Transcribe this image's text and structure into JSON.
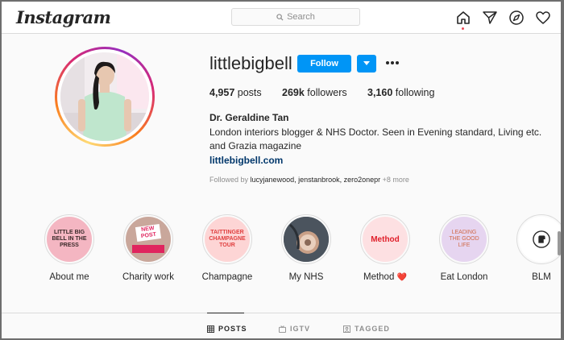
{
  "nav": {
    "logo": "Instagram",
    "search_placeholder": "Search",
    "icons": [
      "home-icon",
      "direct-message-icon",
      "explore-compass-icon",
      "activity-heart-icon"
    ]
  },
  "profile": {
    "username": "littlebigbell",
    "follow_label": "Follow",
    "stats": {
      "posts_count": "4,957",
      "posts_label": "posts",
      "followers_count": "269k",
      "followers_label": "followers",
      "following_count": "3,160",
      "following_label": "following"
    },
    "full_name": "Dr. Geraldine Tan",
    "bio": "London interiors blogger & NHS Doctor. Seen in Evening standard, Living etc. and Grazia magazine",
    "website": "littlebigbell.com",
    "followed_by_prefix": "Followed by",
    "followed_by": "lucyjanewood, jenstanbrook, zero2onepr",
    "followed_by_more": "+8 more"
  },
  "highlights": [
    {
      "label": "About me",
      "cover_text": "LITTLE BIG BELL IN THE PRESS",
      "bg": "#f4b6c2",
      "fg": "#3a2a2a"
    },
    {
      "label": "Charity work",
      "cover_text": "NEW POST",
      "bg": "#c9a79b",
      "fg": "#e0245e"
    },
    {
      "label": "Champagne",
      "cover_text": "TAITTINGER CHAMPAGNE TOUR",
      "bg": "#fdd5d5",
      "fg": "#e04040"
    },
    {
      "label": "My NHS",
      "cover_text": "",
      "bg": "#5a6470",
      "fg": "#ffffff"
    },
    {
      "label": "Method",
      "emoji": "❤️",
      "cover_text": "Method",
      "bg": "#fde0e2",
      "fg": "#e0202b"
    },
    {
      "label": "Eat London",
      "cover_text": "LEADING THE GOOD LIFE",
      "bg": "#e6d5f0",
      "fg": "#d06a4a"
    },
    {
      "label": "BLM",
      "cover_text": "",
      "bg": "#ffffff",
      "fg": "#262626"
    }
  ],
  "tabs": [
    {
      "label": "POSTS",
      "icon": "grid-icon",
      "active": true
    },
    {
      "label": "IGTV",
      "icon": "igtv-icon",
      "active": false
    },
    {
      "label": "TAGGED",
      "icon": "tagged-icon",
      "active": false
    }
  ],
  "colors": {
    "accent": "#0095f6",
    "link": "#00376b",
    "text": "#262626",
    "muted": "#8e8e8e"
  }
}
